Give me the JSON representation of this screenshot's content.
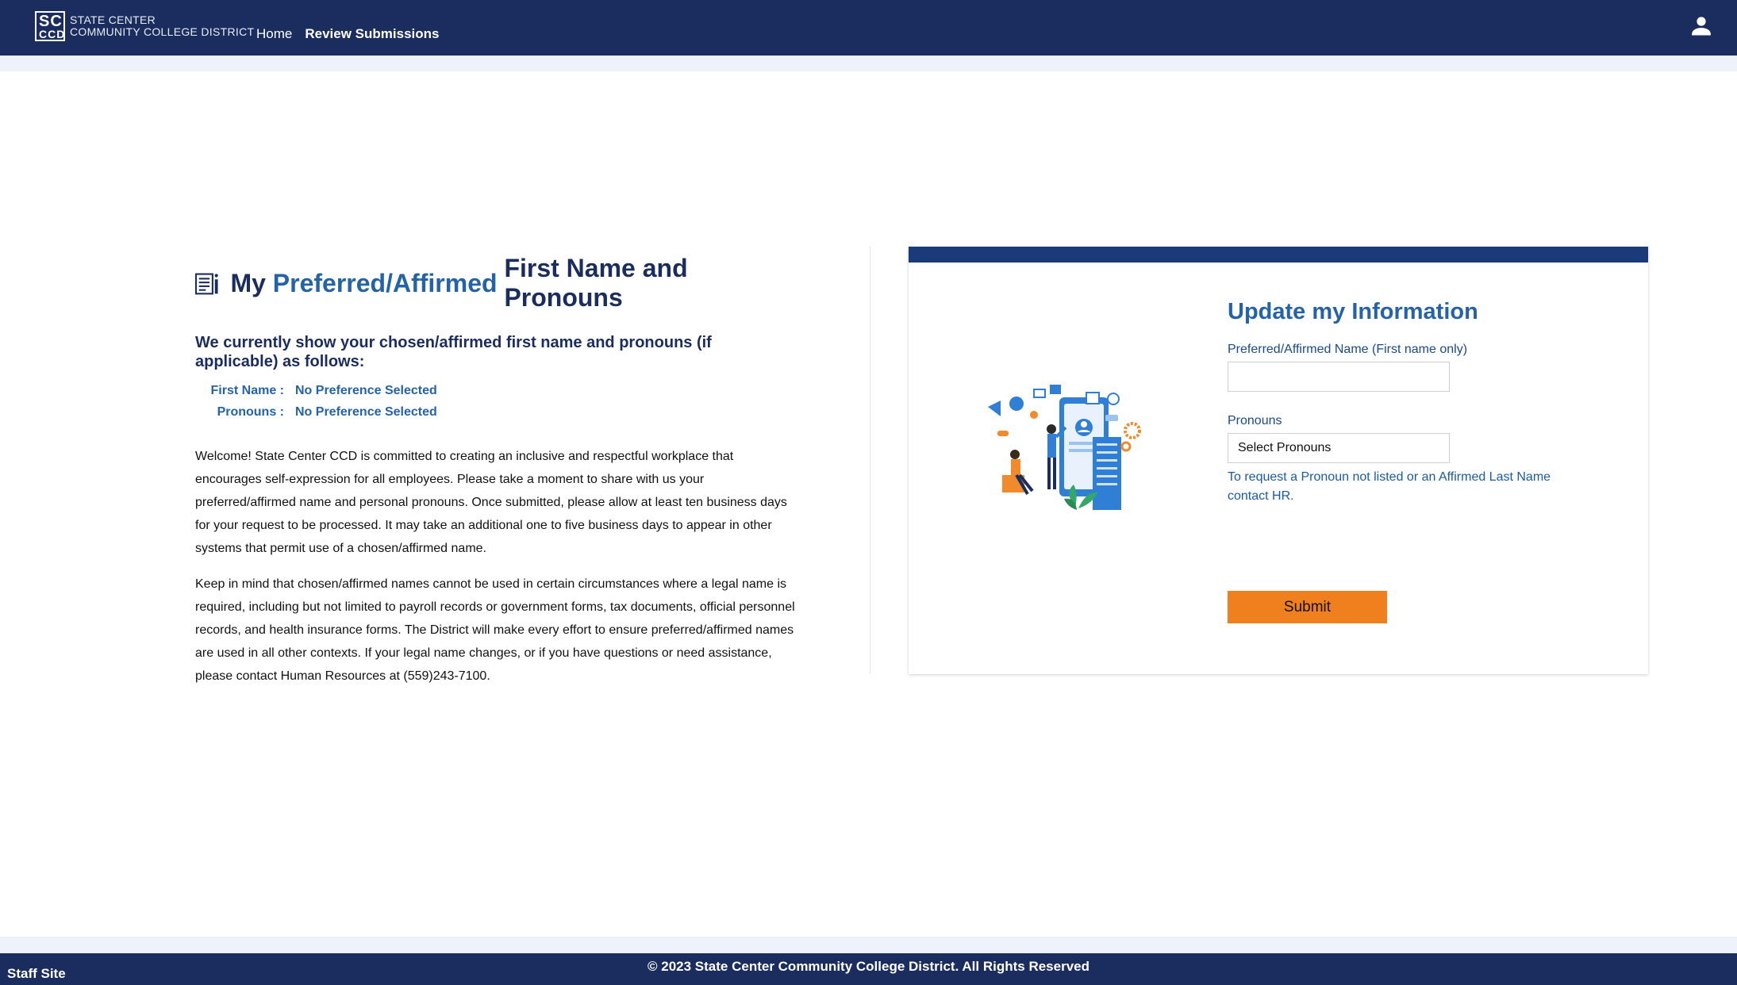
{
  "header": {
    "logo": {
      "mark_top": "SC",
      "mark_bottom": "CCD",
      "line1": "State Center",
      "line2": "Community College District"
    },
    "nav": [
      {
        "label": "Home"
      },
      {
        "label": "Review Submissions"
      }
    ],
    "user_icon": "person-icon"
  },
  "main": {
    "title_prefix": "My",
    "title_accent": "Preferred/Affirmed",
    "title_suffix": "First Name and Pronouns",
    "title_icon": "document-info-icon",
    "subtitle": "We currently show your chosen/affirmed first name and pronouns (if applicable) as follows:",
    "first_name_label": "First Name :",
    "first_name_value": "No Preference Selected",
    "pronouns_label": "Pronouns :",
    "pronouns_value": "No Preference Selected",
    "paragraph1": "Welcome! State Center CCD is committed to creating an inclusive and respectful workplace that encourages self-expression for all employees. Please take a moment to share with us your preferred/affirmed name and personal pronouns. Once submitted, please allow at least ten business days for your request to be processed. It may take an additional one to five business days to appear in other systems that permit use of a chosen/affirmed name.",
    "paragraph2": "Keep in mind that chosen/affirmed names cannot be used in certain circumstances where a legal name is required, including but not limited to payroll records or government forms, tax documents, official personnel records, and health insurance forms. The District will make every effort to ensure preferred/affirmed names are used in all other contexts. If your legal name changes, or if you have questions or need assistance, please contact Human Resources at (559)243-7100."
  },
  "form": {
    "heading": "Update my Information",
    "name_label": "Preferred/Affirmed Name (First name only)",
    "name_value": "",
    "pronouns_label": "Pronouns",
    "pronouns_selected": "Select Pronouns",
    "help_line1": "To request a Pronoun not listed or an Affirmed Last Name",
    "help_line2": "contact HR.",
    "submit_label": "Submit",
    "illustration": "profile-update-illustration"
  },
  "footer": {
    "left": "Staff Site",
    "copyright": "© 2023 State Center Community College District. All Rights Reserved"
  },
  "colors": {
    "navy": "#1a2d5e",
    "accent_blue": "#2563a8",
    "submit_orange": "#f07f1d"
  }
}
